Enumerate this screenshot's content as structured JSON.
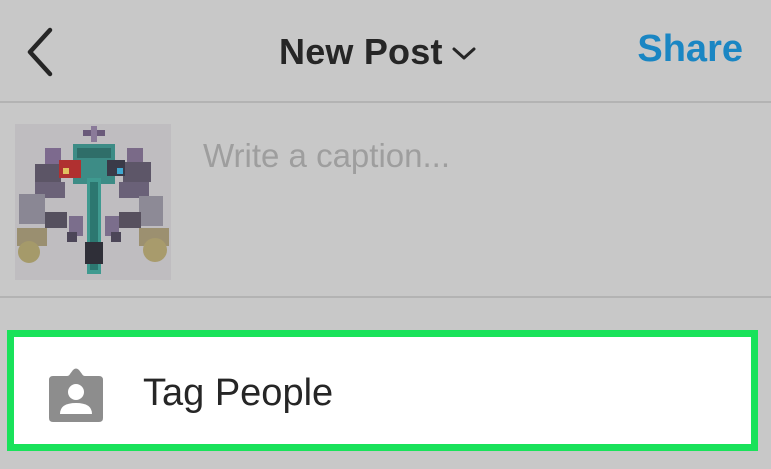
{
  "header": {
    "title": "New Post",
    "share_label": "Share",
    "back_icon": "chevron-left-icon",
    "title_chevron_icon": "chevron-down-icon"
  },
  "caption": {
    "placeholder": "Write a caption...",
    "value": ""
  },
  "tag_people": {
    "label": "Tag People",
    "icon": "person-tag-icon",
    "highlight_color": "#19e25a"
  },
  "colors": {
    "accent": "#1a86c3",
    "background": "#c8c8c8",
    "text": "#262626"
  }
}
